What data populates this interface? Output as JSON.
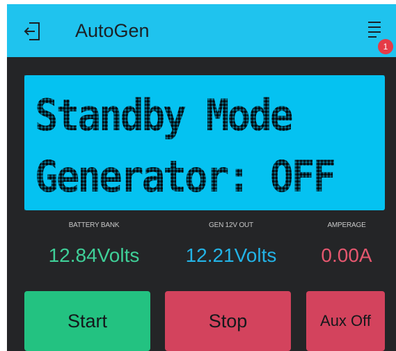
{
  "header": {
    "title": "AutoGen",
    "exit_icon": "exit-door-icon",
    "menu_icon": "hamburger-menu-icon",
    "notification_count": "1"
  },
  "lcd": {
    "line1": "Standby Mode",
    "line2": "Generator: OFF"
  },
  "gauges": [
    {
      "label": "BATTERY BANK",
      "value": "12.84Volts",
      "color": "#3fcf98"
    },
    {
      "label": "GEN 12V OUT",
      "value": "12.21Volts",
      "color": "#23b3e6"
    },
    {
      "label": "AMPERAGE",
      "value": "0.00A",
      "color": "#e5576f"
    }
  ],
  "buttons": {
    "start": "Start",
    "stop": "Stop",
    "aux": "Aux Off"
  },
  "colors": {
    "header": "#1fc3ee",
    "background": "#242527",
    "lcd": "#05c2f1",
    "start": "#23c281",
    "stop": "#d3435d",
    "badge": "#e53b47"
  }
}
